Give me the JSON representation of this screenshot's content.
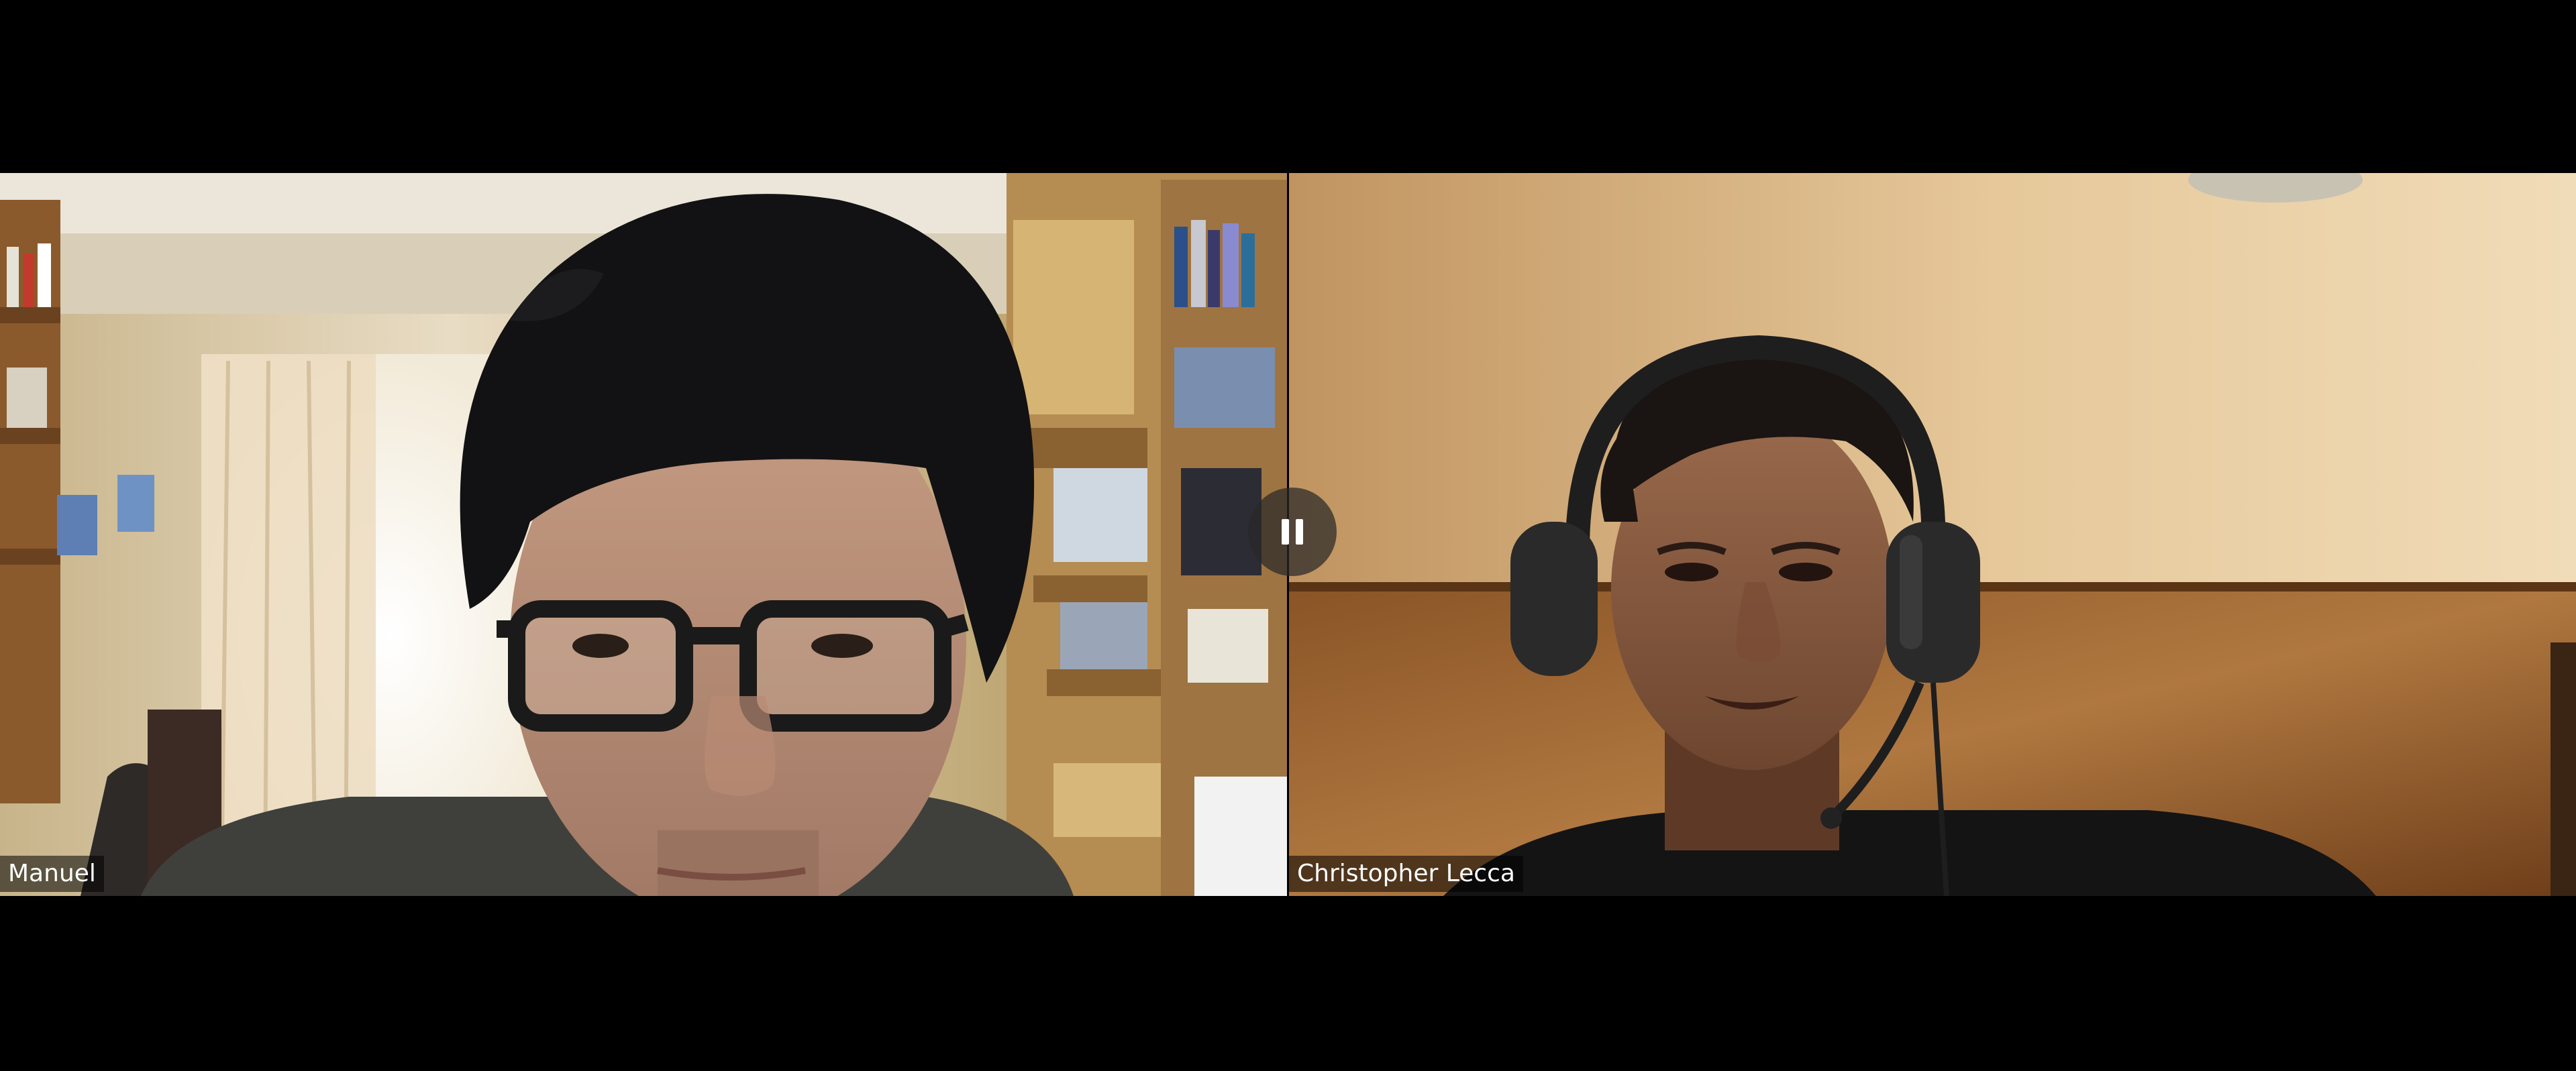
{
  "participants": [
    {
      "name": "Manuel"
    },
    {
      "name": "Christopher Lecca"
    }
  ],
  "controls": {
    "pause_icon": "pause-icon"
  },
  "colors": {
    "background": "#000000",
    "label_text": "#ffffff",
    "pause_button": "#282828"
  }
}
